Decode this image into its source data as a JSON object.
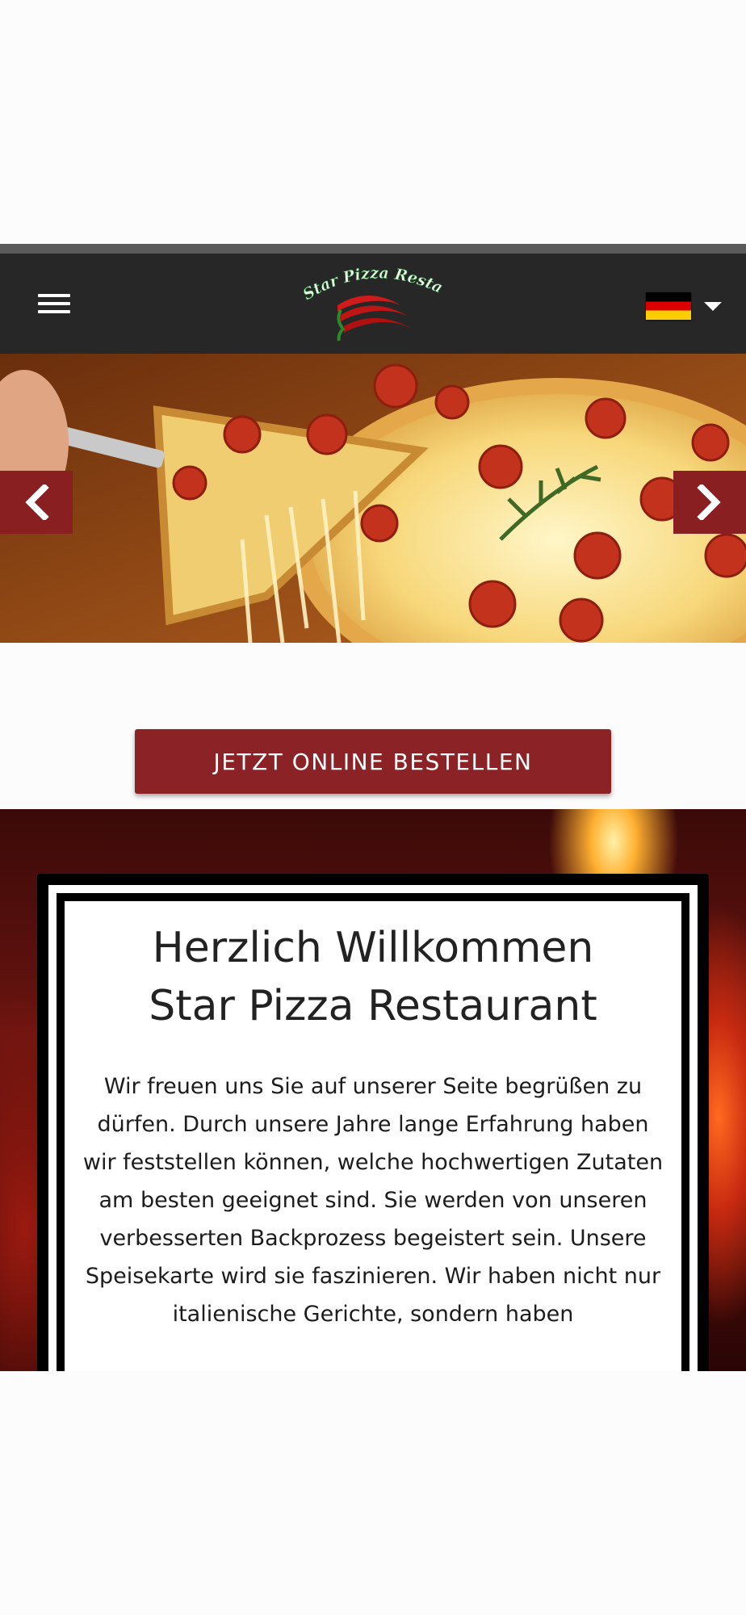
{
  "header": {
    "menu_icon": "hamburger-menu-icon",
    "logo_text": "Star Pizza Restaurant",
    "language_flag": "de",
    "colors": {
      "background": "#272727",
      "topbar": "#5a5a5a"
    }
  },
  "hero": {
    "prev_icon": "chevron-left-icon",
    "next_icon": "chevron-right-icon",
    "image_subject": "pepperoni pizza slice",
    "arrow_color": "#8a1f22"
  },
  "cta": {
    "label": "JETZT ONLINE BESTELLEN",
    "color": "#8a2226"
  },
  "welcome": {
    "title_line1": "Herzlich Willkommen",
    "title_line2": "Star Pizza Restaurant",
    "body": "Wir freuen uns Sie auf unserer Seite begrüßen zu dürfen. Durch unsere Jahre lange Erfahrung haben wir feststellen können, welche hochwertigen Zutaten am besten geeignet sind. Sie werden von unseren verbesserten Backprozess begeistert sein. Unsere Speisekarte wird sie faszinieren. Wir haben nicht nur italienische Gerichte, sondern haben"
  }
}
